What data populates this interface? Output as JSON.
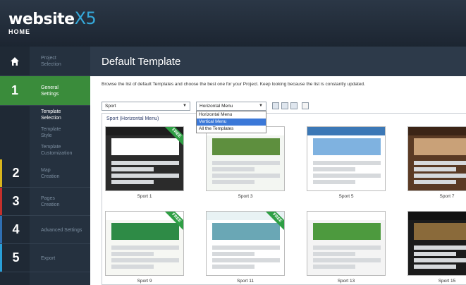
{
  "brand": {
    "name": "website",
    "x5": "X5",
    "home": "HOME"
  },
  "sidebar": [
    {
      "num": "",
      "label": "Project\nSelection",
      "active": false
    },
    {
      "num": "1",
      "label": "General\nSettings",
      "active": true
    },
    {
      "num": "",
      "label": "Template\nSelection",
      "active": false,
      "sub": true,
      "current": true
    },
    {
      "num": "",
      "label": "Template\nStyle",
      "active": false,
      "sub": true
    },
    {
      "num": "",
      "label": "Template\nCustomization",
      "active": false,
      "sub": true
    },
    {
      "num": "2",
      "label": "Map\nCreation",
      "active": false
    },
    {
      "num": "3",
      "label": "Pages\nCreation",
      "active": false
    },
    {
      "num": "4",
      "label": "Advanced Settings",
      "active": false
    },
    {
      "num": "5",
      "label": "Export",
      "active": false
    }
  ],
  "header": {
    "title": "Default Template"
  },
  "content": {
    "description": "Browse the list of default Templates and choose the best one for your Project. Keep looking because the list is constantly updated.",
    "category_select": "Sport",
    "menu_select": "Horizontal Menu",
    "menu_options": [
      "Horizontal Menu",
      "Vertical Menu",
      "All the Templates"
    ],
    "menu_options_selected_index": 1,
    "group_label": "Sport (Horizontal Menu)"
  },
  "templates": [
    {
      "name": "Sport 1",
      "free": true
    },
    {
      "name": "Sport 3",
      "free": false
    },
    {
      "name": "Sport 5",
      "free": false
    },
    {
      "name": "Sport 7",
      "free": false
    },
    {
      "name": "Sport 9",
      "free": true
    },
    {
      "name": "Sport 11",
      "free": true
    },
    {
      "name": "Sport 13",
      "free": false
    },
    {
      "name": "Sport 15",
      "free": false
    }
  ],
  "free_label": "FREE",
  "colors": {
    "accent_green": "#3a8c3b",
    "brand_blue": "#35a8d9",
    "dark_bg": "#25313f"
  }
}
